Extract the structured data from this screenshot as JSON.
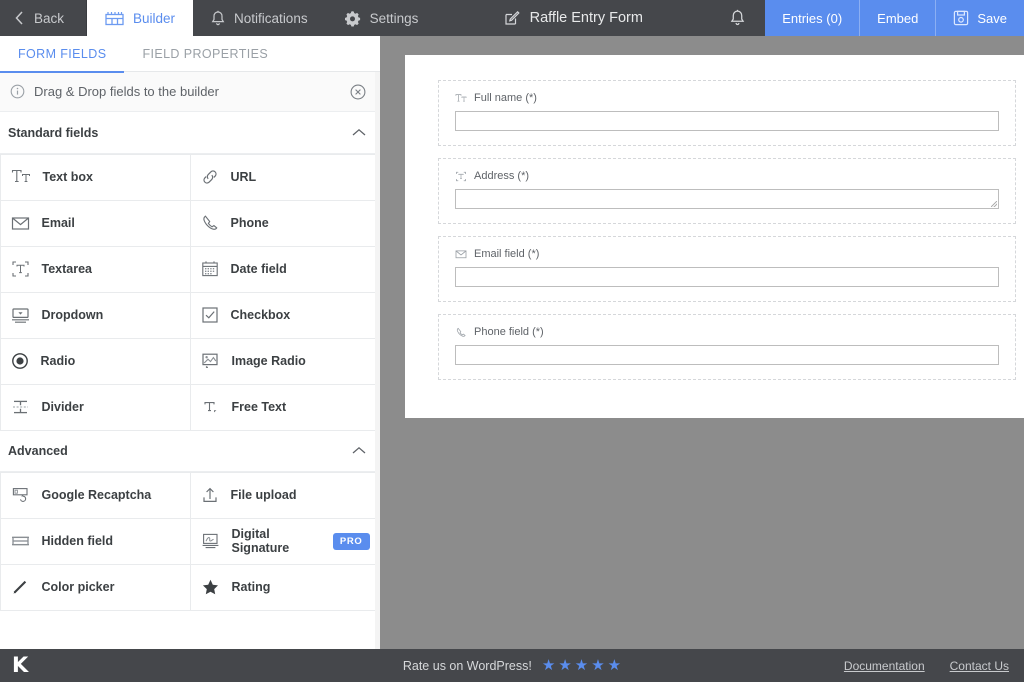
{
  "topbar": {
    "back_label": "Back",
    "nav": [
      {
        "label": "Builder",
        "icon": "builder-icon",
        "active": true
      },
      {
        "label": "Notifications",
        "icon": "bell-icon",
        "active": false
      },
      {
        "label": "Settings",
        "icon": "gear-icon",
        "active": false
      }
    ],
    "form_title": "Raffle Entry Form",
    "title_icon": "edit-pencil-icon",
    "bell_icon": "bell-icon",
    "actions": [
      {
        "label": "Entries (0)",
        "icon": ""
      },
      {
        "label": "Embed",
        "icon": ""
      },
      {
        "label": "Save",
        "icon": "floppy-save-icon"
      }
    ],
    "accent": "#5a8dee",
    "bar_bg": "#45474b"
  },
  "left_panel": {
    "tabs": [
      {
        "label": "FORM FIELDS",
        "active": true
      },
      {
        "label": "FIELD PROPERTIES",
        "active": false
      }
    ],
    "hint": {
      "icon": "info-circle-icon",
      "text": "Drag & Drop fields to the builder",
      "close_icon": "close-circle-icon"
    },
    "groups": [
      {
        "title": "Standard fields",
        "collapse_icon": "chevron-up-icon",
        "fields": [
          {
            "label": "Text box",
            "icon": "text-box-icon"
          },
          {
            "label": "URL",
            "icon": "link-icon"
          },
          {
            "label": "Email",
            "icon": "envelope-icon"
          },
          {
            "label": "Phone",
            "icon": "phone-icon"
          },
          {
            "label": "Textarea",
            "icon": "textarea-icon"
          },
          {
            "label": "Date field",
            "icon": "calendar-icon"
          },
          {
            "label": "Dropdown",
            "icon": "dropdown-icon"
          },
          {
            "label": "Checkbox",
            "icon": "checkbox-icon"
          },
          {
            "label": "Radio",
            "icon": "radio-icon"
          },
          {
            "label": "Image Radio",
            "icon": "image-radio-icon"
          },
          {
            "label": "Divider",
            "icon": "divider-icon"
          },
          {
            "label": "Free Text",
            "icon": "free-text-icon"
          }
        ]
      },
      {
        "title": "Advanced",
        "collapse_icon": "chevron-up-icon",
        "fields": [
          {
            "label": "Google Recaptcha",
            "icon": "recaptcha-icon"
          },
          {
            "label": "File upload",
            "icon": "upload-icon"
          },
          {
            "label": "Hidden field",
            "icon": "hidden-field-icon"
          },
          {
            "label": "Digital Signature",
            "icon": "signature-icon",
            "badge": "PRO"
          },
          {
            "label": "Color picker",
            "icon": "pen-icon"
          },
          {
            "label": "Rating",
            "icon": "star-icon"
          }
        ]
      }
    ]
  },
  "canvas": {
    "fields": [
      {
        "label": "Full name (*)",
        "icon": "text-box-icon",
        "type": "text"
      },
      {
        "label": "Address (*)",
        "icon": "textarea-icon",
        "type": "textarea"
      },
      {
        "label": "Email field (*)",
        "icon": "envelope-icon",
        "type": "text"
      },
      {
        "label": "Phone field (*)",
        "icon": "phone-icon",
        "type": "text"
      }
    ]
  },
  "footer": {
    "logo": "K",
    "rate_text": "Rate us on WordPress!",
    "star_count": 5,
    "star_color": "#5a8dee",
    "links": [
      "Documentation",
      "Contact Us"
    ]
  }
}
